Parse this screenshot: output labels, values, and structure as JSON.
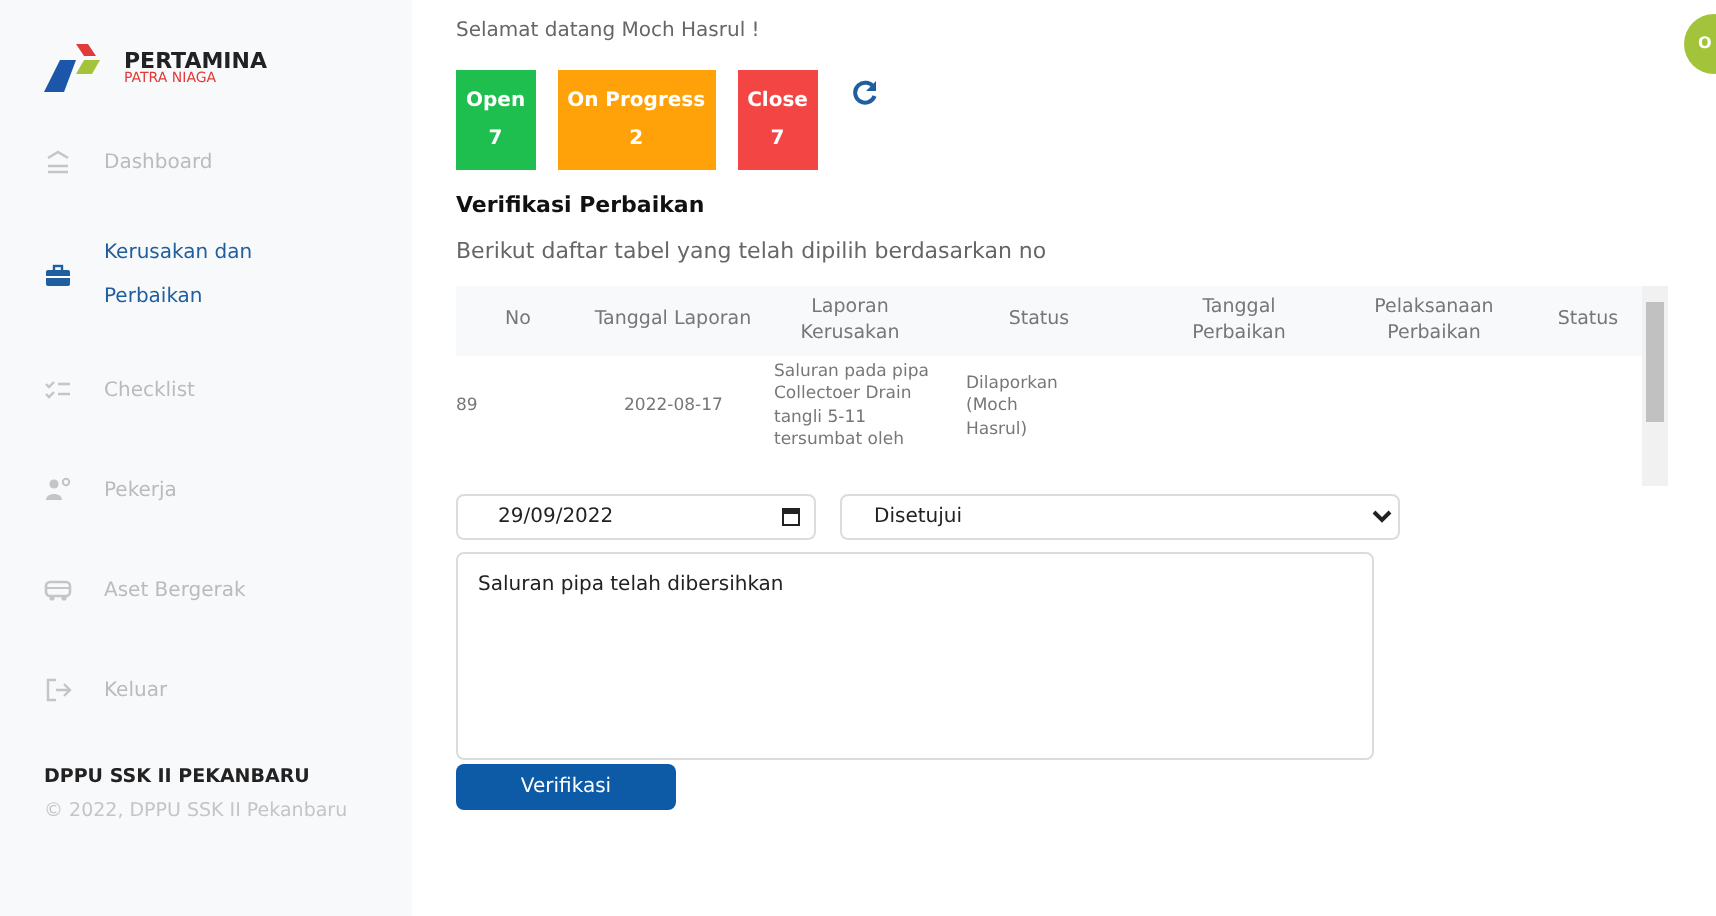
{
  "sidebar": {
    "logo": {
      "name": "PERTAMINA",
      "subtitle": "PATRA NIAGA"
    },
    "items": [
      {
        "label": "Dashboard",
        "kind": "dashboard",
        "selected": false
      },
      {
        "label": "Kerusakan dan Perbaikan",
        "kind": "toolbox",
        "selected": true
      },
      {
        "label": "Checklist",
        "kind": "checklist",
        "selected": false
      },
      {
        "label": "Pekerja",
        "kind": "workers",
        "selected": false
      },
      {
        "label": "Aset Bergerak",
        "kind": "vehicle",
        "selected": false
      },
      {
        "label": "Keluar",
        "kind": "logout",
        "selected": false
      }
    ],
    "footer": {
      "title": "DPPU SSK II PEKANBARU",
      "copyright": "© 2022, DPPU SSK II Pekanbaru"
    }
  },
  "welcome": "Selamat datang Moch Hasrul !",
  "avatar": {
    "initials": "O"
  },
  "status_cards": [
    {
      "label": "Open",
      "count": "7",
      "color": "#1fbf4f"
    },
    {
      "label": "On Progress",
      "count": "2",
      "color": "#ffa20a"
    },
    {
      "label": "Close",
      "count": "7",
      "color": "#f44545"
    }
  ],
  "title": "Verifikasi Perbaikan",
  "subtitle": "Berikut daftar tabel yang telah dipilih berdasarkan no",
  "table": {
    "columns": [
      "No",
      "Tanggal Laporan",
      "Laporan Kerusakan",
      "Status",
      "Tanggal Perbaikan",
      "Pelaksanaan Perbaikan",
      "Status"
    ],
    "rows": [
      [
        "89",
        "2022-08-17",
        "Saluran pada pipa Collectoer Drain tangli 5-11 tersumbat oleh",
        "Dilaporkan (Moch Hasrul)",
        "",
        "",
        ""
      ]
    ]
  },
  "form": {
    "date": "29/09/2022",
    "decision": "Disetujui",
    "notes": "Saluran pipa telah dibersihkan",
    "submit": "Verifikasi"
  }
}
